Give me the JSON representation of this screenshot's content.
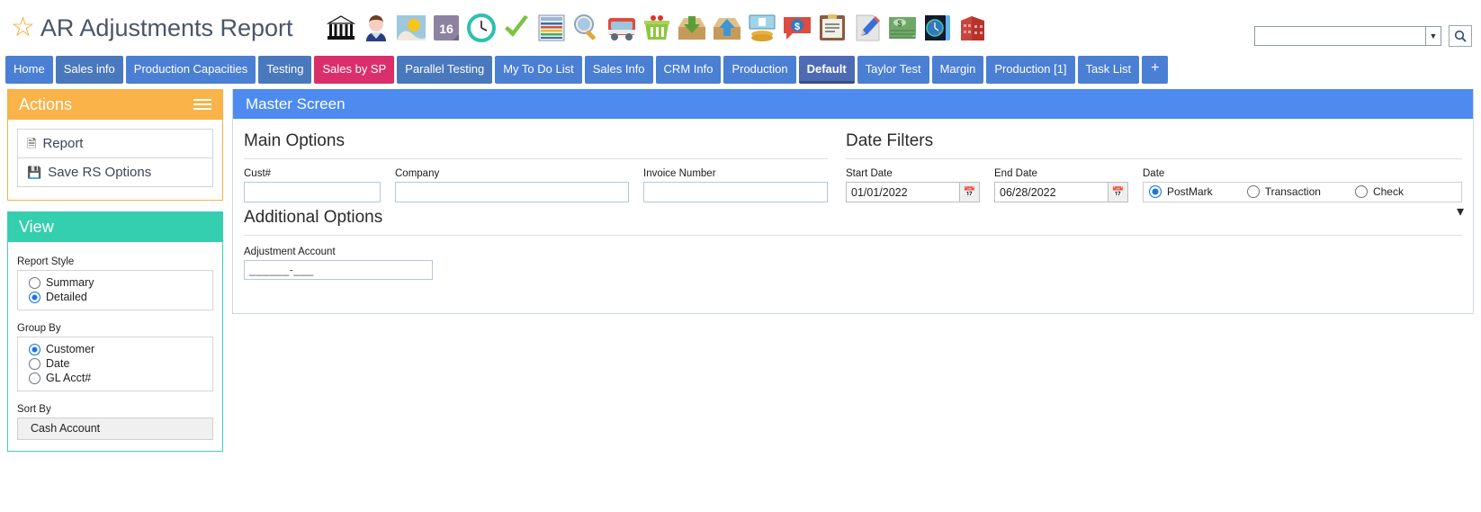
{
  "app": {
    "title": "AR Adjustments Report",
    "star_icon": "star-icon"
  },
  "toolbar": {
    "icons": [
      {
        "name": "bank-icon",
        "label": "Bank"
      },
      {
        "name": "contact-person-icon",
        "label": "Contact"
      },
      {
        "name": "weather-icon",
        "label": "Weather"
      },
      {
        "name": "calendar-16-icon",
        "label": "16"
      },
      {
        "name": "clock-icon",
        "label": "Clock"
      },
      {
        "name": "check-mark-icon",
        "label": "Check"
      },
      {
        "name": "ledger-icon",
        "label": "Ledger"
      },
      {
        "name": "magnifier-globe-icon",
        "label": "Search"
      },
      {
        "name": "truck-icon",
        "label": "Truck"
      },
      {
        "name": "basket-icon",
        "label": "Basket"
      },
      {
        "name": "inbox-download-icon",
        "label": "Receive"
      },
      {
        "name": "outbox-upload-icon",
        "label": "Send"
      },
      {
        "name": "cash-payment-icon",
        "label": "Payment"
      },
      {
        "name": "dollar-chat-icon",
        "label": "Quote"
      },
      {
        "name": "clipboard-icon",
        "label": "Clipboard"
      },
      {
        "name": "pencil-document-icon",
        "label": "Edit"
      },
      {
        "name": "money-stack-icon",
        "label": "Money"
      },
      {
        "name": "world-clock-icon",
        "label": "Time Zones"
      },
      {
        "name": "red-building-icon",
        "label": "Building"
      }
    ]
  },
  "search": {
    "value": "",
    "placeholder": "",
    "dropdown_icon": "chevron-down-icon",
    "button_icon": "search-icon"
  },
  "tabs": [
    {
      "label": "Home",
      "style": "normal"
    },
    {
      "label": "Sales info",
      "style": "muted"
    },
    {
      "label": "Production Capacities",
      "style": "normal"
    },
    {
      "label": "Testing",
      "style": "muted"
    },
    {
      "label": "Sales by SP",
      "style": "pink"
    },
    {
      "label": "Parallel Testing",
      "style": "muted"
    },
    {
      "label": "My To Do List",
      "style": "normal"
    },
    {
      "label": "Sales Info",
      "style": "normal"
    },
    {
      "label": "CRM Info",
      "style": "normal"
    },
    {
      "label": "Production",
      "style": "normal"
    },
    {
      "label": "Default",
      "style": "active"
    },
    {
      "label": "Taylor Test",
      "style": "normal"
    },
    {
      "label": "Margin",
      "style": "normal"
    },
    {
      "label": "Production [1]",
      "style": "normal"
    },
    {
      "label": "Task List",
      "style": "normal"
    },
    {
      "label": "+",
      "style": "plus"
    }
  ],
  "actions_panel": {
    "title": "Actions",
    "menu_icon": "hamburger-icon",
    "items": [
      {
        "label": "Report",
        "icon": "document-icon",
        "glyph": "◨"
      },
      {
        "label": "Save RS Options",
        "icon": "save-disk-icon",
        "glyph": "Ὃe"
      }
    ]
  },
  "view_panel": {
    "title": "View",
    "report_style": {
      "label": "Report Style",
      "options": [
        {
          "label": "Summary",
          "selected": false
        },
        {
          "label": "Detailed",
          "selected": true
        }
      ]
    },
    "group_by": {
      "label": "Group By",
      "options": [
        {
          "label": "Customer",
          "selected": true
        },
        {
          "label": "Date",
          "selected": false
        },
        {
          "label": "GL Acct#",
          "selected": false
        }
      ]
    },
    "sort_by": {
      "label": "Sort By",
      "value": "Cash Account"
    }
  },
  "master": {
    "header": "Master Screen",
    "main_options": {
      "title": "Main Options",
      "fields": [
        {
          "label": "Cust#",
          "value": "",
          "name": "cust-number-input"
        },
        {
          "label": "Company",
          "value": "",
          "name": "company-input"
        },
        {
          "label": "Invoice Number",
          "value": "",
          "name": "invoice-number-input"
        }
      ]
    },
    "date_filters": {
      "title": "Date Filters",
      "start": {
        "label": "Start Date",
        "value": "01/01/2022",
        "icon": "calendar-icon"
      },
      "end": {
        "label": "End Date",
        "value": "06/28/2022",
        "icon": "calendar-icon"
      },
      "date_type": {
        "label": "Date",
        "options": [
          {
            "label": "PostMark",
            "selected": true
          },
          {
            "label": "Transaction",
            "selected": false
          },
          {
            "label": "Check",
            "selected": false
          }
        ]
      }
    },
    "additional_options": {
      "title": "Additional Options",
      "collapse_icon": "chevron-down-icon",
      "adjustment_account": {
        "label": "Adjustment Account",
        "value": "______-___"
      }
    }
  },
  "colors": {
    "tab_blue": "#4a7fd4",
    "tab_pink": "#da2f6b",
    "tab_active": "#4d6bb5",
    "header_blue": "#4d8bf0",
    "actions_orange": "#f9b348",
    "view_teal": "#34cfae",
    "radio_blue": "#1a73e8",
    "star_gold": "#f5a623"
  }
}
